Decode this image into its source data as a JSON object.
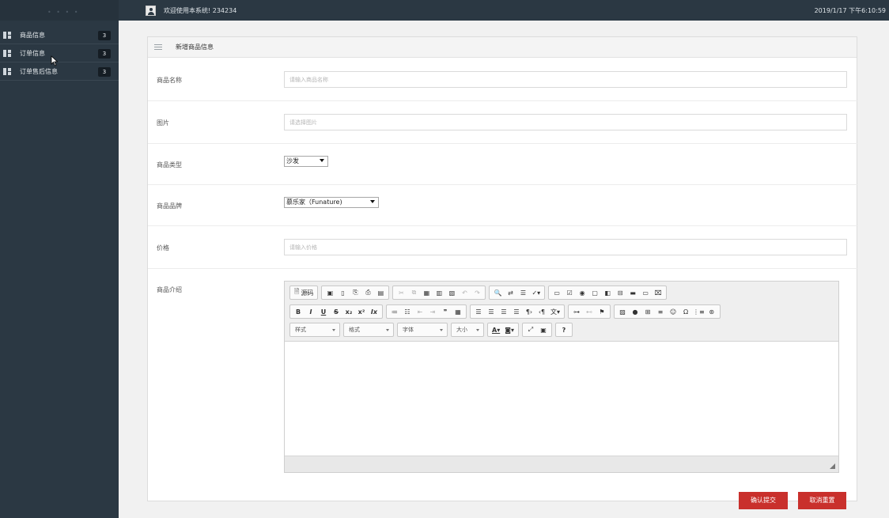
{
  "header": {
    "welcome": "欢迎使用本系统! 234234",
    "datetime": "2019/1/17 下午6:10:59",
    "brand_dots": "• • • •"
  },
  "sidebar": {
    "items": [
      {
        "label": "商品信息",
        "badge": "3"
      },
      {
        "label": "订单信息",
        "badge": "3"
      },
      {
        "label": "订单售后信息",
        "badge": "3"
      }
    ]
  },
  "panel": {
    "title": "新增商品信息"
  },
  "form": {
    "name": {
      "label": "商品名称",
      "placeholder": "请输入商品名称"
    },
    "image": {
      "label": "图片",
      "placeholder": "请选择图片"
    },
    "type": {
      "label": "商品类型",
      "value": "沙发"
    },
    "brand": {
      "label": "商品品牌",
      "value": "慕乐家（Funature)"
    },
    "price": {
      "label": "价格",
      "placeholder": "请输入价格"
    },
    "intro": {
      "label": "商品介绍"
    }
  },
  "editor": {
    "source_label": "源码",
    "styles_label": "样式",
    "format_label": "格式",
    "font_label": "字体",
    "size_label": "大小",
    "help_label": "?"
  },
  "actions": {
    "submit_label": "确认提交",
    "reset_label": "取消重置"
  },
  "colors": {
    "topbar": "#2b3843",
    "accent_button": "#c9302c"
  }
}
